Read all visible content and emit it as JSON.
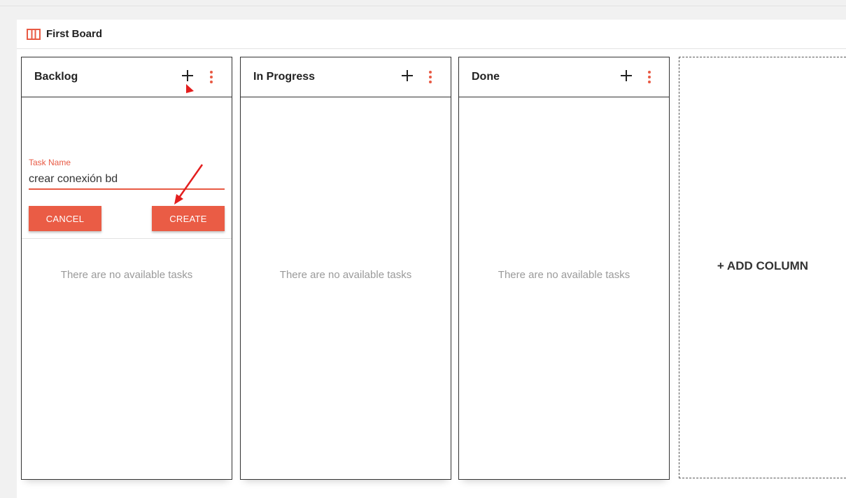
{
  "board": {
    "title": "First Board",
    "icon": "board-columns-icon",
    "accent_color": "#e85a44"
  },
  "columns": [
    {
      "title": "Backlog",
      "empty_text": "There are no available tasks",
      "add_icon": "plus-icon",
      "menu_icon": "more-vertical-icon"
    },
    {
      "title": "In Progress",
      "empty_text": "There are no available tasks",
      "add_icon": "plus-icon",
      "menu_icon": "more-vertical-icon"
    },
    {
      "title": "Done",
      "empty_text": "There are no available tasks",
      "add_icon": "plus-icon",
      "menu_icon": "more-vertical-icon"
    }
  ],
  "task_form": {
    "label": "Task Name",
    "value": "crear conexión bd",
    "cancel_label": "CANCEL",
    "create_label": "CREATE"
  },
  "add_column": {
    "label": "+ ADD COLUMN"
  }
}
